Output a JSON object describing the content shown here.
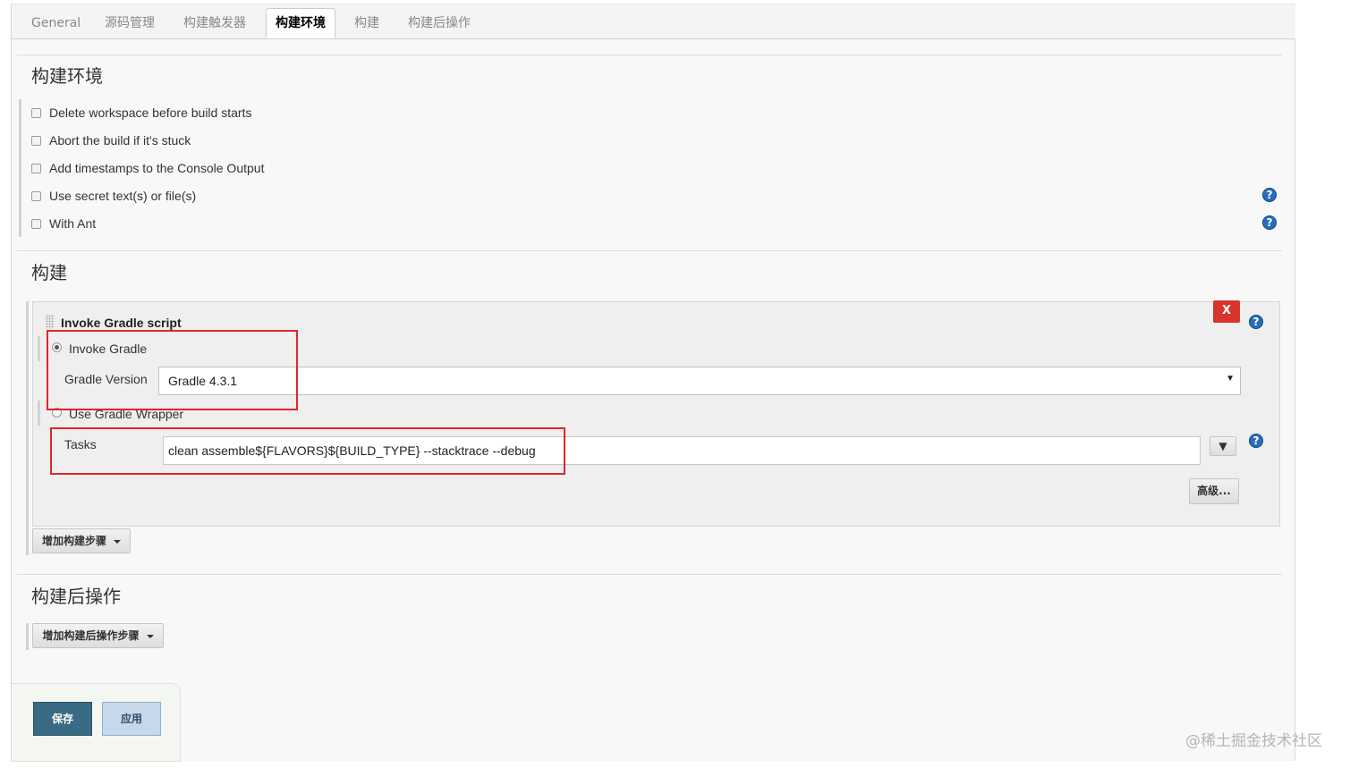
{
  "tabs": [
    {
      "label": "General",
      "active": false
    },
    {
      "label": "源码管理",
      "active": false
    },
    {
      "label": "构建触发器",
      "active": false
    },
    {
      "label": "构建环境",
      "active": true
    },
    {
      "label": "构建",
      "active": false
    },
    {
      "label": "构建后操作",
      "active": false
    }
  ],
  "build_env": {
    "title": "构建环境",
    "options": [
      {
        "label": "Delete workspace before build starts",
        "checked": false,
        "has_help": false
      },
      {
        "label": "Abort the build if it's stuck",
        "checked": false,
        "has_help": false
      },
      {
        "label": "Add timestamps to the Console Output",
        "checked": false,
        "has_help": false
      },
      {
        "label": "Use secret text(s) or file(s)",
        "checked": false,
        "has_help": true
      },
      {
        "label": "With Ant",
        "checked": false,
        "has_help": true
      }
    ]
  },
  "build": {
    "title": "构建",
    "step": {
      "title": "Invoke Gradle script",
      "delete_label": "X",
      "invoke_gradle_label": "Invoke Gradle",
      "invoke_gradle_selected": true,
      "gradle_version_label": "Gradle Version",
      "gradle_version_value": "Gradle 4.3.1",
      "use_wrapper_label": "Use Gradle Wrapper",
      "use_wrapper_selected": false,
      "tasks_label": "Tasks",
      "tasks_value": "clean assemble${FLAVORS}${BUILD_TYPE} --stacktrace --debug",
      "expand_symbol": "▼",
      "advanced_label": "高级..."
    },
    "add_step_label": "增加构建步骤"
  },
  "post_build": {
    "title": "构建后操作",
    "add_step_label": "增加构建后操作步骤"
  },
  "footer": {
    "save_label": "保存",
    "apply_label": "应用"
  },
  "help_symbol": "?",
  "dropdown_symbol": "▼",
  "watermark": "@稀土掘金技术社区",
  "colors": {
    "highlight_box": "#e0262b",
    "save_button": "#3a6b84",
    "apply_button": "#c6d8ea",
    "delete_button": "#d9342b",
    "help_icon": "#2a6cb8"
  }
}
